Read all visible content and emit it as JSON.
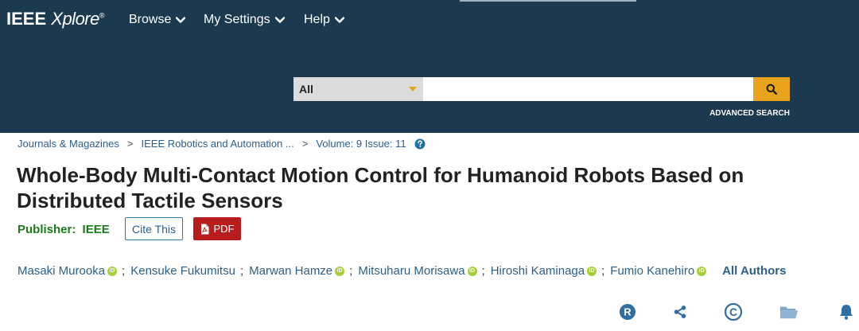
{
  "brand": {
    "name": "IEEE",
    "product": "Xplore",
    "mark": "®"
  },
  "nav": [
    {
      "label": "Browse"
    },
    {
      "label": "My Settings"
    },
    {
      "label": "Help"
    }
  ],
  "search": {
    "scope": "All",
    "query": "",
    "placeholder": "",
    "advanced_label": "ADVANCED SEARCH"
  },
  "breadcrumbs": [
    {
      "label": "Journals & Magazines"
    },
    {
      "label": "IEEE Robotics and Automation ..."
    },
    {
      "label": "Volume: 9 Issue: 11"
    }
  ],
  "article": {
    "title": "Whole-Body Multi-Contact Motion Control for Humanoid Robots Based on Distributed Tactile Sensors",
    "publisher_label": "Publisher:",
    "publisher": "IEEE",
    "cite_label": "Cite This",
    "pdf_label": "PDF"
  },
  "authors": [
    {
      "name": "Masaki Murooka"
    },
    {
      "name": "Kensuke Fukumitsu"
    },
    {
      "name": "Marwan Hamze"
    },
    {
      "name": "Mitsuharu Morisawa"
    },
    {
      "name": "Hiroshi Kaminaga"
    },
    {
      "name": "Fumio Kanehiro"
    }
  ],
  "orcid_label": "iD",
  "all_authors_label": "All Authors",
  "tools": {
    "rights_label": "R",
    "copyright_label": "©"
  },
  "colors": {
    "header": "#1c3a4f",
    "accent": "#e8a21c",
    "link": "#2c5f8a",
    "publisher": "#1b7a1b",
    "pdf": "#b91c1c",
    "orcid": "#a6ce39",
    "tool_icon": "#2f6ea3"
  },
  "icons": [
    "chevron-down-icon",
    "search-icon",
    "help-icon",
    "pdf-icon",
    "orcid-icon",
    "rights-icon",
    "share-icon",
    "copyright-icon",
    "folder-icon",
    "bell-icon"
  ]
}
